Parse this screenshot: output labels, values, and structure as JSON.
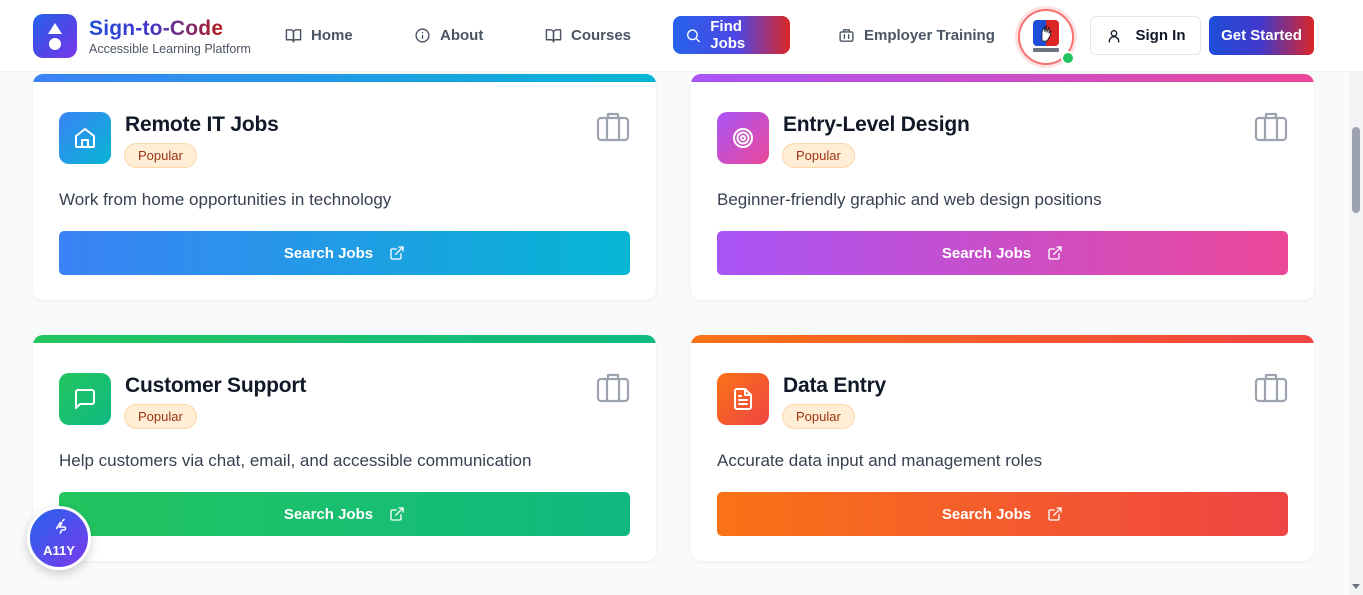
{
  "brand": {
    "title": "Sign-to-Code",
    "subtitle": "Accessible Learning Platform"
  },
  "nav": {
    "items": [
      {
        "label": "Home",
        "icon": "book-open-icon",
        "active": false
      },
      {
        "label": "About",
        "icon": "info-icon",
        "active": false
      },
      {
        "label": "Courses",
        "icon": "book-open-icon",
        "active": false
      },
      {
        "label": "Find Jobs",
        "icon": "search-icon",
        "active": true
      },
      {
        "label": "Employer Training",
        "icon": "building-icon",
        "active": false
      }
    ]
  },
  "header_actions": {
    "sign_in": "Sign In",
    "get_started": "Get Started"
  },
  "cards": [
    {
      "title": "Remote IT Jobs",
      "badge": "Popular",
      "description": "Work from home opportunities in technology",
      "button": "Search Jobs",
      "icon": "home-icon",
      "colors": [
        "#3b82f6",
        "#06b6d4"
      ]
    },
    {
      "title": "Entry-Level Design",
      "badge": "Popular",
      "description": "Beginner-friendly graphic and web design positions",
      "button": "Search Jobs",
      "icon": "target-icon",
      "colors": [
        "#a855f7",
        "#ec4899"
      ]
    },
    {
      "title": "Customer Support",
      "badge": "Popular",
      "description": "Help customers via chat, email, and accessible communication",
      "button": "Search Jobs",
      "icon": "message-square-icon",
      "colors": [
        "#22c55e",
        "#10b981"
      ]
    },
    {
      "title": "Data Entry",
      "badge": "Popular",
      "description": "Accurate data input and management roles",
      "button": "Search Jobs",
      "icon": "file-text-icon",
      "colors": [
        "#f97316",
        "#ef4444"
      ]
    }
  ],
  "a11y_widget": {
    "label": "A11Y"
  }
}
